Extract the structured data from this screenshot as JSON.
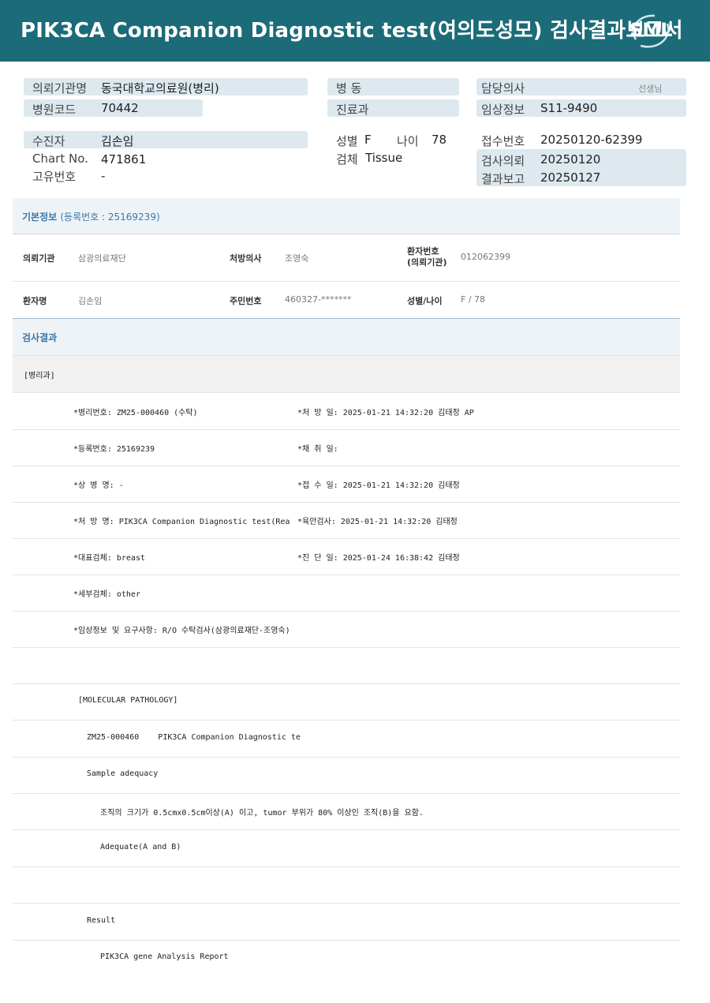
{
  "banner": {
    "title": "PIK3CA  Companion  Diagnostic  test(여의도성모) 검사결과보고서",
    "logo": "SML"
  },
  "header": {
    "institution_label": "의뢰기관명",
    "institution_value": "동국대학교의료원(병리)",
    "hospital_code_label": "병원코드",
    "hospital_code_value": "70442",
    "ward_label": "병  동",
    "dept_label": "진료과",
    "doctor_label": "담당의사",
    "doctor_suffix": "선생님",
    "clinical_label": "임상정보",
    "clinical_value": "S11-9490",
    "patient_label": "수진자",
    "patient_value": "김손임",
    "chart_label": "Chart No.",
    "chart_value": "471861",
    "unique_label": "고유번호",
    "unique_value": "-",
    "sex_label": "성별",
    "sex_value": "F",
    "age_label": "나이",
    "age_value": "78",
    "specimen_label": "검체",
    "specimen_value": "Tissue",
    "receipt_label": "접수번호",
    "receipt_value": "20250120-62399",
    "request_label": "검사의뢰",
    "request_value": "20250120",
    "report_label": "결과보고",
    "report_value": "20250127"
  },
  "basic": {
    "title": "기본정보",
    "reg_no": "(등록번호 : 25169239)",
    "rows": [
      {
        "k1": "의뢰기관",
        "v1": "삼광의료재단",
        "k2": "처방의사",
        "v2": "조영숙",
        "k3": "환자번호\n(의뢰기관)",
        "v3": "012062399"
      },
      {
        "k1": "환자명",
        "v1": "김손임",
        "k2": "주민번호",
        "v2": "460327-*******",
        "k3": "성별/나이",
        "v3": "F / 78"
      }
    ]
  },
  "result": {
    "title": "검사결과",
    "dept": "[병리과]",
    "lines": [
      {
        "left": "*병리번호: ZM25-000460 (수탁)",
        "right": "*처 방 일: 2025-01-21 14:32:20  김태정 AP"
      },
      {
        "left": "*등록번호: 25169239",
        "right": "*채 취 일:"
      },
      {
        "left": "*상 병 명: -",
        "right": "*접 수 일: 2025-01-21 14:32:20  김태정"
      },
      {
        "left": "*처 방 명: PIK3CA Companion Diagnostic test(Rea",
        "right": "*육안검사: 2025-01-21 14:32:20  김태정"
      },
      {
        "left": "*대표검체: breast",
        "right": "*진 단 일: 2025-01-24 16:38:42  김태정"
      },
      {
        "left": "*세부검체: other",
        "right": ""
      },
      {
        "left": "*임상정보 및 요구사항: R/O 수탁검사(삼광의료재단-조영숙)",
        "right": ""
      }
    ],
    "molecular": "[MOLECULAR PATHOLOGY]",
    "zm_line": "ZM25-000460    PIK3CA Companion Diagnostic te",
    "adequacy": "Sample adequacy",
    "criteria": "조직의 크기가 0.5cmx0.5cm이상(A) 이고, tumor 부위가 80% 이상인 조직(B)을 요함.",
    "adequate": "Adequate(A and B)",
    "result_label": "Result",
    "report_label": "PIK3CA gene Analysis Report"
  }
}
